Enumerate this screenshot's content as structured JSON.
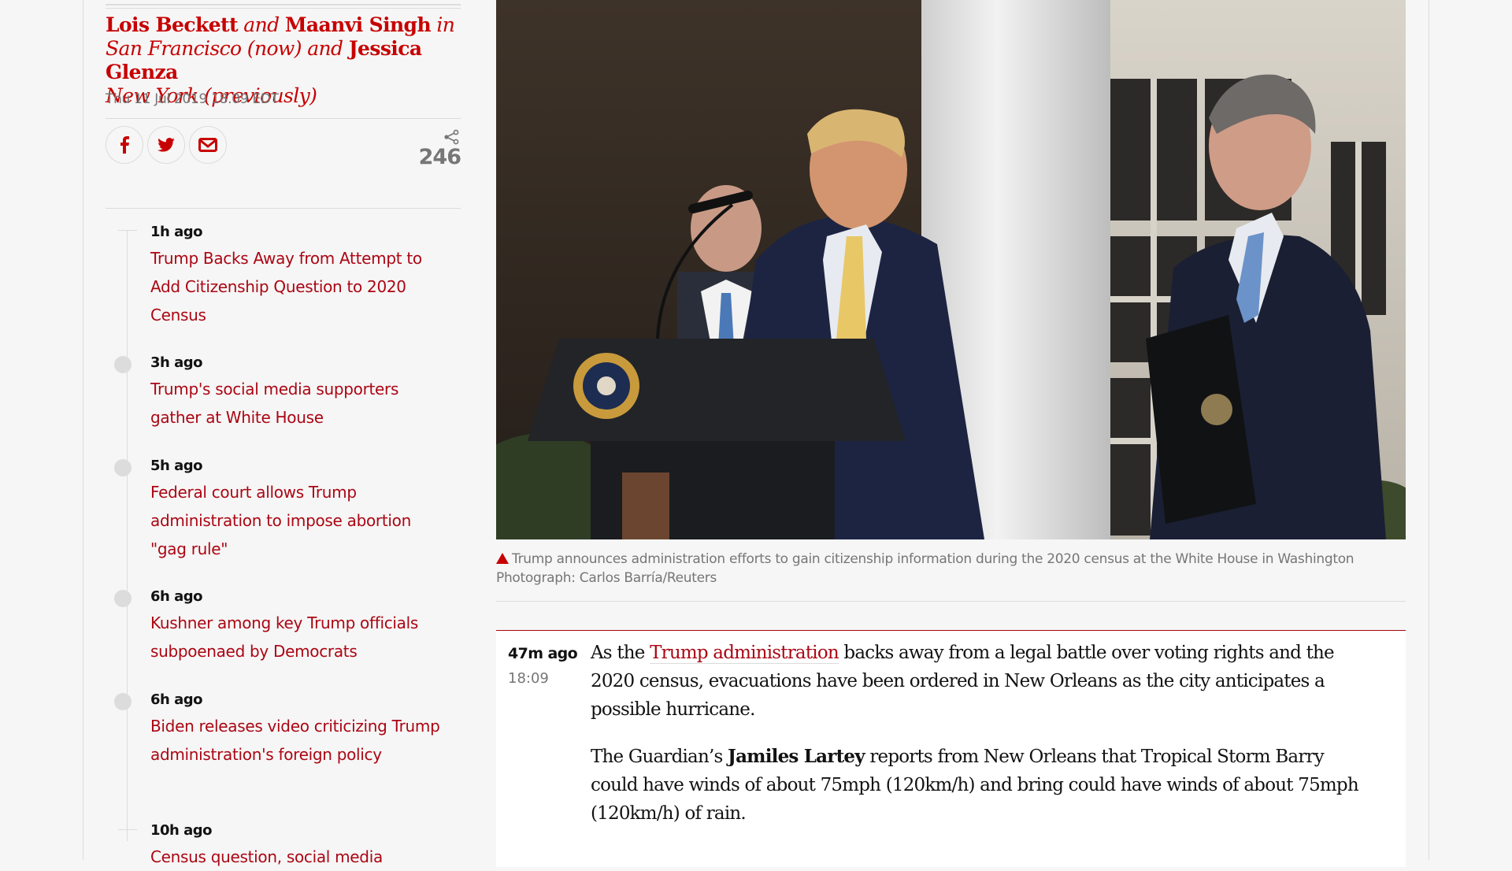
{
  "byline": {
    "author1": "Lois Beckett",
    "conj1": "and",
    "author2": "Maanvi Singh",
    "location1": "in San Francisco (now)",
    "conj2": "and",
    "author3": "Jessica Glenza",
    "location2": "New York (previously)"
  },
  "dateline": "Thu 11 Jul 2019 18.09 EDT",
  "share": {
    "buttons": [
      {
        "name": "facebook",
        "icon": "facebook-icon"
      },
      {
        "name": "twitter",
        "icon": "twitter-icon"
      },
      {
        "name": "email",
        "icon": "email-icon"
      }
    ],
    "count_icon": "share-icon",
    "count": "246"
  },
  "timeline": {
    "items": [
      {
        "time": "1h ago",
        "title": "Trump Backs Away from Attempt to Add Citizenship Question to 2020 Census"
      },
      {
        "time": "3h ago",
        "title": "Trump's social media supporters gather at White House"
      },
      {
        "time": "5h ago",
        "title": "Federal court allows Trump administration to impose abortion \"gag rule\""
      },
      {
        "time": "6h ago",
        "title": "Kushner among key Trump officials subpoenaed by Democrats"
      },
      {
        "time": "6h ago",
        "title": "Biden releases video criticizing Trump administration's foreign policy"
      },
      {
        "time": "10h ago",
        "title": "Census question, social media"
      }
    ]
  },
  "hero": {
    "alt": "Trump speaking at a presidential podium flanked by two officials"
  },
  "caption": {
    "icon": "triangle-up-icon",
    "text": "Trump announces administration efforts to gain citizenship information during the 2020 census at the White House in Washington",
    "credit": "Photograph: Carlos Barría/Reuters"
  },
  "block": {
    "ago": "47m ago",
    "time": "18:09",
    "p1_pre": "As the ",
    "p1_link": "Trump administration",
    "p1_post": " backs away from a legal battle over voting rights and the 2020 census, evacuations have been ordered in New Orleans as the city anticipates a possible hurricane.",
    "p2_pre": "The Guardian’s ",
    "p2_bold": "Jamiles Lartey",
    "p2_post": " reports from New Orleans that Tropical Storm Barry could have winds of about 75mph (120km/h) and bring could have winds of about 75mph (120km/h) of rain."
  },
  "colors": {
    "accent": "#c70000",
    "link": "#ab0613",
    "muted": "#767676",
    "rule": "#dcdcdc",
    "background": "#f6f6f6"
  }
}
